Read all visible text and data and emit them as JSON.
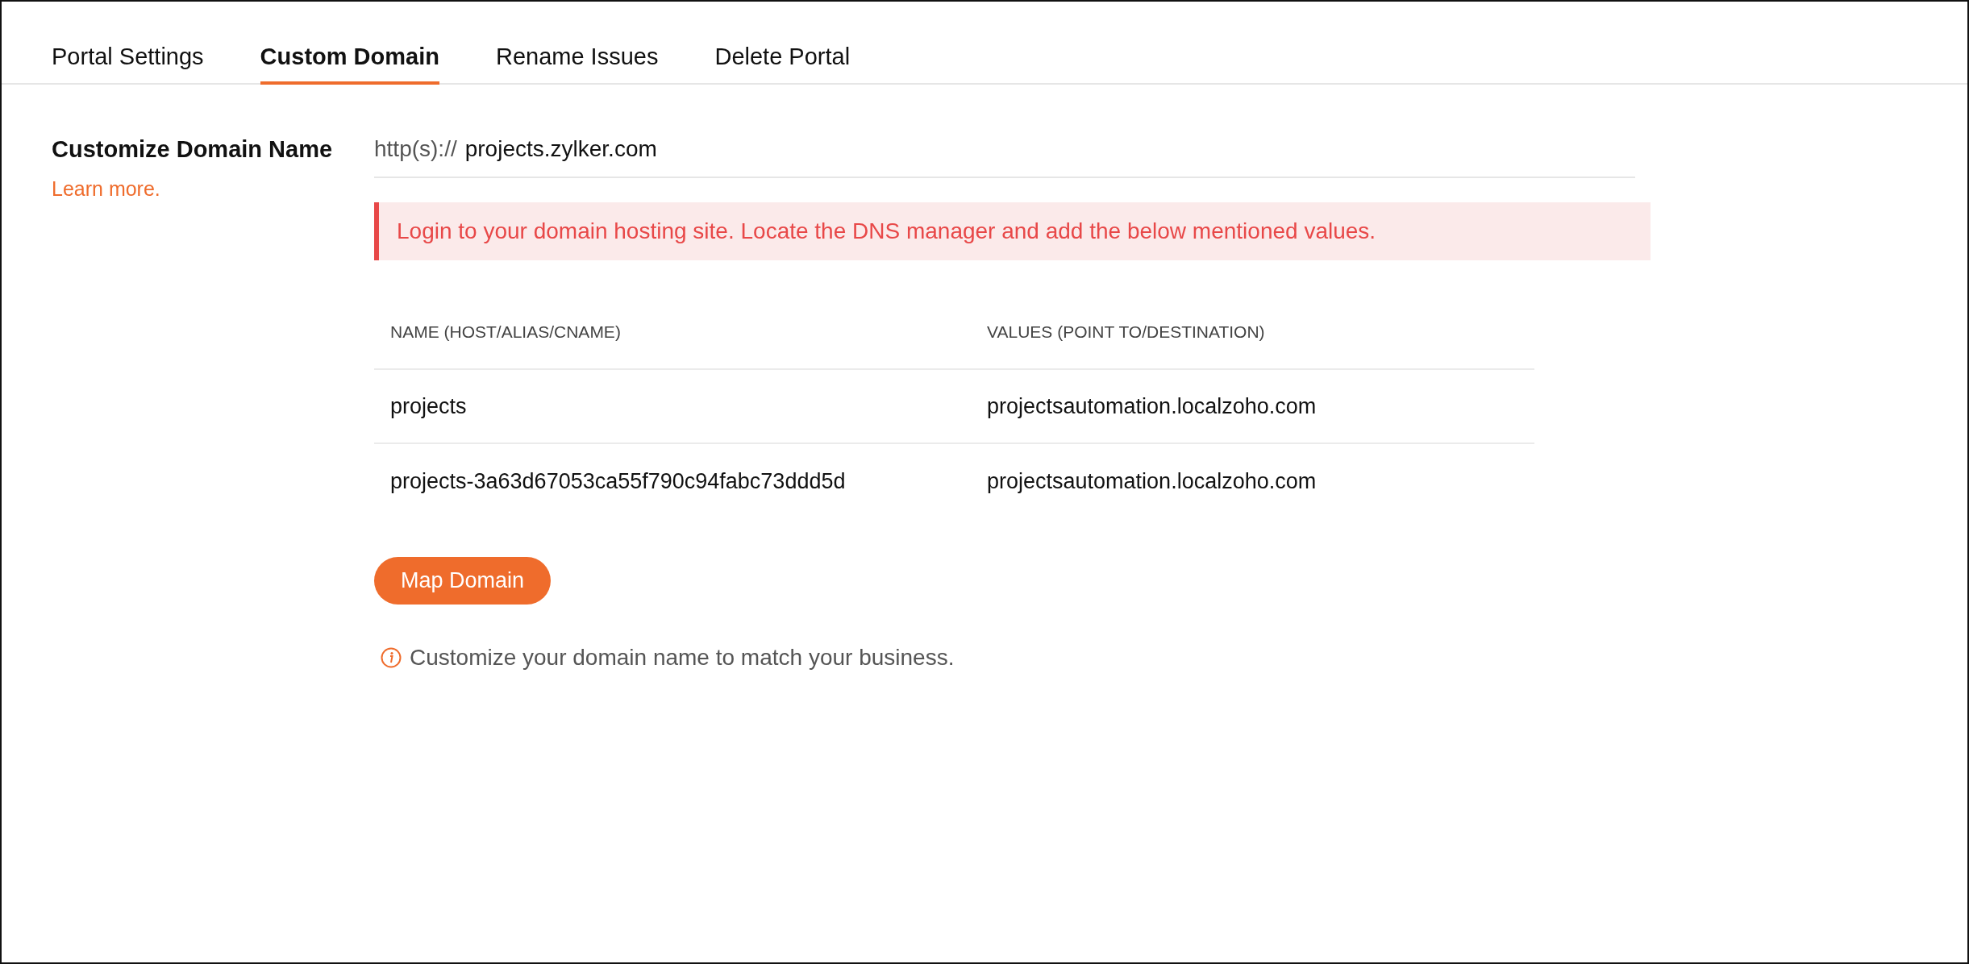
{
  "tabs": [
    {
      "label": "Portal Settings",
      "selected": false
    },
    {
      "label": "Custom Domain",
      "selected": true
    },
    {
      "label": "Rename Issues",
      "selected": false
    },
    {
      "label": "Delete Portal",
      "selected": false
    }
  ],
  "section": {
    "title": "Customize Domain Name",
    "link": "Learn more."
  },
  "domain_field": {
    "prefix": "http(s)://",
    "value": "projects.zylker.com"
  },
  "alert": "Login to your domain hosting site. Locate the DNS manager and add the below mentioned values.",
  "table": {
    "columns": [
      "NAME (HOST/ALIAS/CNAME)",
      "VALUES (POINT TO/DESTINATION)"
    ],
    "rows": [
      [
        "projects",
        "projectsautomation.localzoho.com"
      ],
      [
        "projects-3a63d67053ca55f790c94fabc73ddd5d",
        "projectsautomation.localzoho.com"
      ]
    ]
  },
  "button": "Map Domain",
  "hint": "Customize your domain name to match your business."
}
